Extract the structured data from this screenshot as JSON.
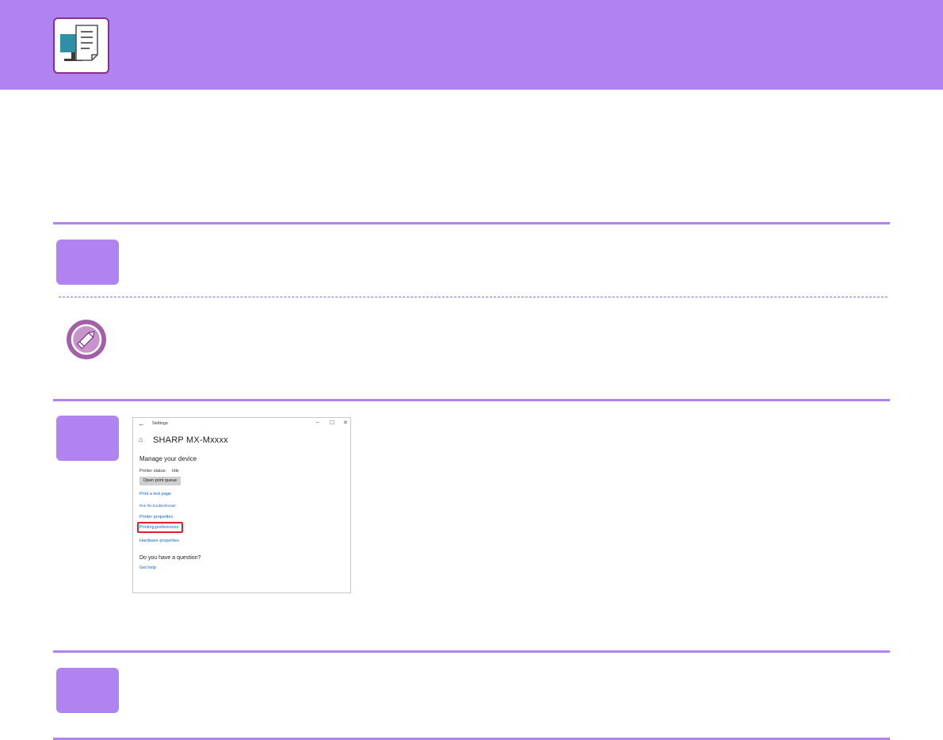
{
  "header": {
    "icon": "computer-document-icon",
    "band_color": "#b083f1",
    "icon_border_color": "#8b2f8e"
  },
  "steps": [
    {
      "badge_color": "#b083f1"
    },
    {
      "badge_color": "#b083f1"
    },
    {
      "badge_color": "#b083f1"
    }
  ],
  "note": {
    "icon": "pencil-note-icon",
    "color": "#a360a9"
  },
  "settings_window": {
    "title": "Settings",
    "back_icon": "←",
    "minimize_icon": "–",
    "maximize_icon": "☐",
    "close_icon": "✕",
    "home_icon": "⌂",
    "device_name": "SHARP MX-Mxxxx",
    "section_title": "Manage your device",
    "printer_status_label": "Printer status:",
    "printer_status_value": "Idle",
    "open_queue_button": "Open print queue",
    "links": {
      "print_test_page": "Print a test page",
      "run_troubleshooter": "Run the troubleshooter",
      "printer_properties": "Printer properties",
      "printing_preferences": "Printing preferences",
      "hardware_properties": "Hardware properties"
    },
    "question": "Do you have a question?",
    "get_help": "Get help",
    "highlight_color": "#e0202e"
  }
}
